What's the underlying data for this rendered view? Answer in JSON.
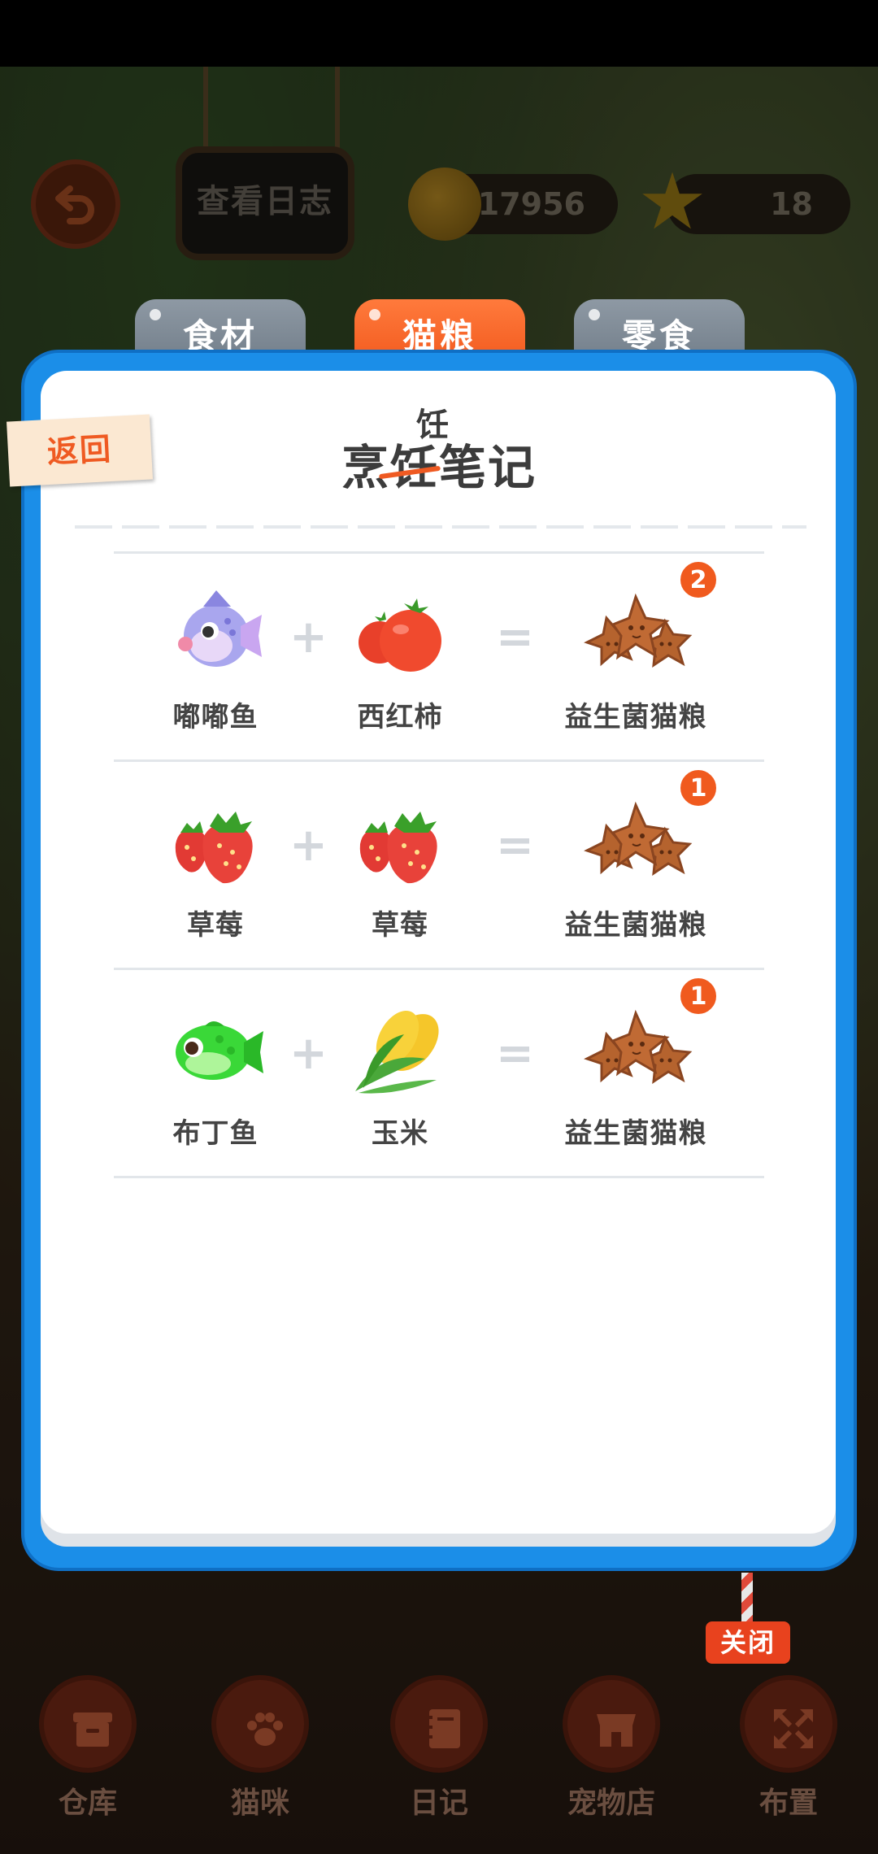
{
  "hud": {
    "log_label": "查看日志",
    "coins": "17956",
    "stars": "18"
  },
  "tabs": [
    {
      "label": "食材",
      "active": false
    },
    {
      "label": "猫粮",
      "active": true
    },
    {
      "label": "零食",
      "active": false
    }
  ],
  "return_label": "返回",
  "title": {
    "text": "烹饪笔记",
    "correction": "饪"
  },
  "recipes": [
    {
      "ingredient_a": {
        "name": "嘟嘟鱼",
        "icon": "puffer-fish-icon"
      },
      "ingredient_b": {
        "name": "西红柿",
        "icon": "tomato-icon"
      },
      "result": {
        "name": "益生菌猫粮",
        "icon": "star-biscuit-icon",
        "count": "2"
      }
    },
    {
      "ingredient_a": {
        "name": "草莓",
        "icon": "strawberry-icon"
      },
      "ingredient_b": {
        "name": "草莓",
        "icon": "strawberry-icon"
      },
      "result": {
        "name": "益生菌猫粮",
        "icon": "star-biscuit-icon",
        "count": "1"
      }
    },
    {
      "ingredient_a": {
        "name": "布丁鱼",
        "icon": "green-fish-icon"
      },
      "ingredient_b": {
        "name": "玉米",
        "icon": "corn-icon"
      },
      "result": {
        "name": "益生菌猫粮",
        "icon": "star-biscuit-icon",
        "count": "1"
      }
    }
  ],
  "operators": {
    "plus": "+",
    "equals": "="
  },
  "close_label": "关闭",
  "nav": [
    {
      "label": "仓库",
      "icon": "box-icon"
    },
    {
      "label": "猫咪",
      "icon": "paw-icon"
    },
    {
      "label": "日记",
      "icon": "notebook-icon"
    },
    {
      "label": "宠物店",
      "icon": "shop-icon"
    },
    {
      "label": "布置",
      "icon": "expand-icon"
    }
  ],
  "colors": {
    "accent": "#ef5418",
    "panel_blue": "#1b8ee8",
    "tab_gray": "#7a8590",
    "badge": "#f05a1e"
  }
}
